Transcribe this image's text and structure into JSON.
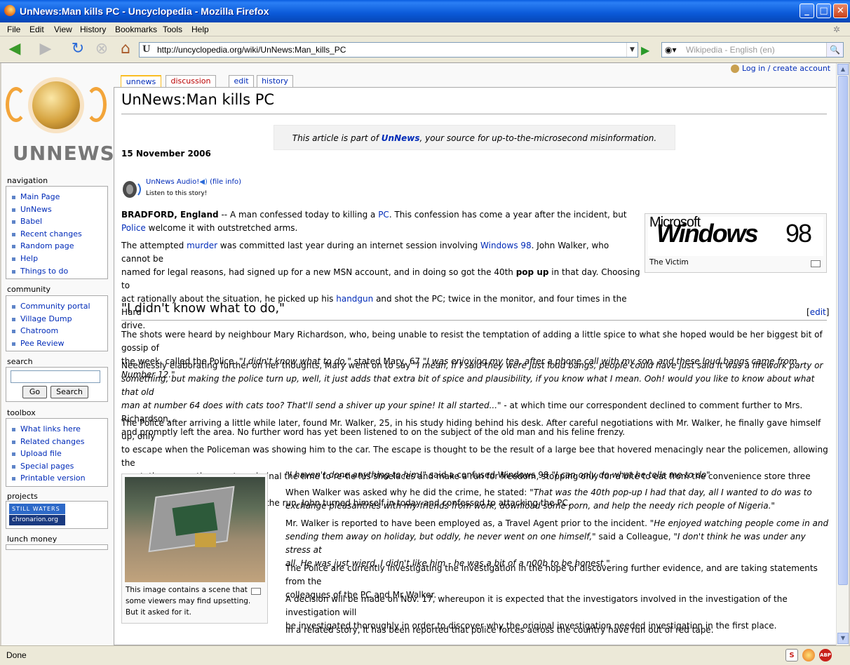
{
  "window": {
    "title": "UnNews:Man kills PC - Uncyclopedia - Mozilla Firefox",
    "minimize": "_",
    "maximize": "□",
    "close": "✕"
  },
  "menu": [
    "File",
    "Edit",
    "View",
    "History",
    "Bookmarks",
    "Tools",
    "Help"
  ],
  "navbar": {
    "url": "http://uncyclopedia.org/wiki/UnNews:Man_kills_PC",
    "search_placeholder": "Wikipedia - English (en)"
  },
  "status": {
    "text": "Done"
  },
  "sidebar": {
    "logo_text": "UNNEWS",
    "navigation": {
      "title": "navigation",
      "items": [
        "Main Page",
        "UnNews",
        "Babel",
        "Recent changes",
        "Random page",
        "Help",
        "Things to do"
      ]
    },
    "community": {
      "title": "community",
      "items": [
        "Community portal",
        "Village Dump",
        "Chatroom",
        "Pee Review"
      ]
    },
    "search": {
      "title": "search",
      "go": "Go",
      "search": "Search"
    },
    "toolbox": {
      "title": "toolbox",
      "items": [
        "What links here",
        "Related changes",
        "Upload file",
        "Special pages",
        "Printable version"
      ]
    },
    "projects": {
      "title": "projects",
      "badge1": "STILL WATERS",
      "badge2": "chronarion.org"
    },
    "lunch": {
      "title": "lunch money"
    }
  },
  "tabs": {
    "unnews": "unnews",
    "discussion": "discussion",
    "edit": "edit",
    "history": "history"
  },
  "personal": {
    "login": "Log in / create account"
  },
  "article": {
    "title": "UnNews:Man kills PC",
    "notice_pre": "This article is part of ",
    "notice_link": "UnNews",
    "notice_post": ", your source for up-to-the-microsecond misinformation.",
    "date": "15 November 2006",
    "audio_link": "UnNews Audio!",
    "audio_info": "(file info)",
    "audio_listen": "Listen to this story!",
    "p1": {
      "a": "BRADFORD, England",
      "b": " -- A man confessed today to killing a ",
      "c": "PC",
      "d": ". This confession has come a year after the incident, but",
      "e": "Police",
      "f": " welcome it with outstretched arms."
    },
    "p2": {
      "a": "The attempted ",
      "b": "murder",
      "c": " was committed last year during an internet session involving ",
      "d": "Windows 98",
      "e": ". John Walker, who cannot be",
      "f": "named for legal reasons, had signed up for a new MSN account, and in doing so got the 40th ",
      "g": "pop up",
      "h": " in that day. Choosing to",
      "i": "act rationally about the situation, he picked up his ",
      "j": "handgun",
      "k": " and shot the PC; twice in the monitor, and four times in the Hard",
      "l": "drive."
    },
    "img1_brand": "Microsoft",
    "img1_title": "Windows",
    "img1_ver": "98",
    "img1_caption": "The Victim",
    "h2": "\"I didn't know what to do,\"",
    "edit_section": "edit",
    "p3": {
      "a": "The shots were heard by neighbour Mary Richardson, who, being unable to resist the temptation of adding a little spice to what she hoped would be her biggest bit of gossip of",
      "b": "the week, called the Police. ",
      "c": "\"I didn't know what to do,\"",
      "d": " stated Mary, 67 ",
      "e": "\"I was enjoying my tea, after a phone call with my son, and these loud bangs came from Number 12.\""
    },
    "p4": {
      "a": "Needlessly elaborating further on her thoughts, Mary went on to say ",
      "b": "\"I mean, If I said they were just loud bangs, people could have just said it was a firework party or",
      "c": "something, but making the police turn up, well, it just adds that extra bit of spice and plausibility, if you know what I mean. Ooh! would you like to know about what that old",
      "d": "man at number 64 does with cats too? That'll send a shiver up your spine! It all started...\"",
      "e": " - at which time our correspondent declined to comment further to Mrs. Richardson,",
      "f": "and promptly left the area. No further word has yet been listened to on the subject of the old man and his feline frenzy."
    },
    "p5": {
      "a": "The Police after arriving a little while later, found Mr. Walker, 25, in his study hiding behind his desk. After careful negotiations with Mr. Walker, he finally gave himself up, only",
      "b": "to escape when the Policeman was showing him to the car. The escape is thought to be the result of a large bee that hovered menacingly near the policemen, allowing the",
      "c": "gun-toting computing master criminal the time to re-tie his shoelaces and make a run for freedom, stopping only for a bite to eat from the convenience store three doors down.",
      "d": "However, after a year of being on the run, John turned himself in today and confessed to attacking the PC."
    },
    "img2_caption": [
      "This image contains a scene that",
      "some viewers may find upsetting.",
      "But it asked for it."
    ],
    "p6": {
      "a": "\"I haven't done anything to him!\"",
      "b": " said a confused Windows 98 ",
      "c": "\"I can only do what he tells me to do\""
    },
    "p7": {
      "a": "When Walker was asked why he did the crime, he stated: ",
      "b": "\"That was the 40th pop-up I had that day, all I wanted to do was to",
      "c": "exchange pleasantries with my friends from work, download some porn, and help the needy rich people of Nigeria.\""
    },
    "p8": {
      "a": "Mr. Walker is reported to have been employed as, a Travel Agent prior to the incident. ",
      "b": "\"He enjoyed watching people come in and",
      "c": "sending them away on holiday, but oddly, he never went on one himself,\"",
      "d": " said a Colleague, ",
      "e": "\"I don't think he was under any stress at",
      "f": "all. He was just wierd. I didn't like him - he was a bit of a n00b to be honest.\""
    },
    "p9": {
      "a": "The Police are currently investigating the investigation in the hope of discovering further evidence, and are taking statements from the",
      "b": "colleagues of the PC and Mr Walker."
    },
    "p10": {
      "a": "A decision will be made on Nov. 17, whereupon it is expected that the investigators involved in the investigation of the investigation will",
      "b": "be investigated thoroughly in order to discover why the original investigation needed investigation in the first place."
    },
    "p11": "In a related story, It has been reported that police forces across the country have run out of red tape."
  },
  "colors": {
    "link": "#002bb8",
    "titlebar": "#0a59d8"
  }
}
